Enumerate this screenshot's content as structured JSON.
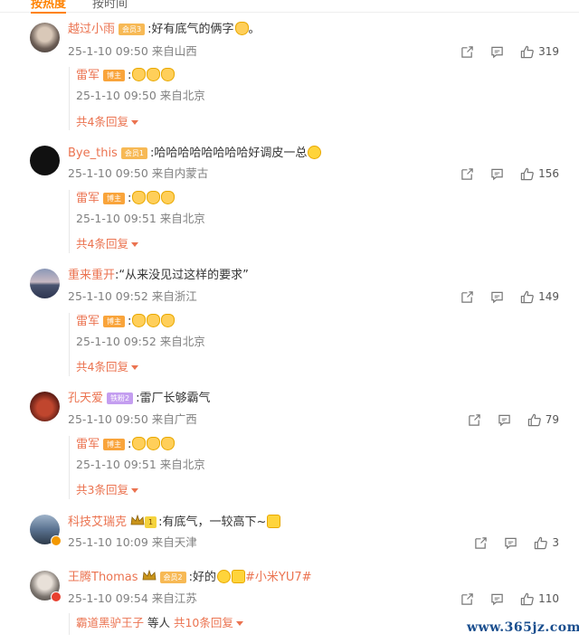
{
  "tabs": [
    {
      "label": "按热度",
      "active": true
    },
    {
      "label": "按时间",
      "active": false
    }
  ],
  "comments": [
    {
      "user": "越过小雨",
      "badge": "会员3",
      "text": ":好有底气的俩字",
      "meta": "25-1-10 09:50 来自山西",
      "likes": "319",
      "reply": {
        "user": "雷军",
        "tag": "博主",
        "text": ":",
        "meta": "25-1-10 09:50 来自北京"
      },
      "more": "共4条回复"
    },
    {
      "user": "Bye_this",
      "badge": "会员1",
      "text": ":哈哈哈哈哈哈哈哈好调皮一总",
      "meta": "25-1-10 09:50 来自内蒙古",
      "likes": "156",
      "reply": {
        "user": "雷军",
        "tag": "博主",
        "text": ":",
        "meta": "25-1-10 09:51 来自北京"
      },
      "more": "共4条回复"
    },
    {
      "user": "重来重开",
      "badge": "",
      "text": ":“从来没见过这样的要求”",
      "meta": "25-1-10 09:52 来自浙江",
      "likes": "149",
      "reply": {
        "user": "雷军",
        "tag": "博主",
        "text": ":",
        "meta": "25-1-10 09:52 来自北京"
      },
      "more": "共4条回复"
    },
    {
      "user": "孔天爱",
      "badge": "铁粉2",
      "text": ":雷厂长够霸气",
      "meta": "25-1-10 09:50 来自广西",
      "likes": "79",
      "reply": {
        "user": "雷军",
        "tag": "博主",
        "text": ":",
        "meta": "25-1-10 09:51 来自北京"
      },
      "more": "共3条回复"
    },
    {
      "user": "科技艾瑞克",
      "badge": "1",
      "text": ":有底气，一较高下~",
      "meta": "25-1-10 10:09 来自天津",
      "likes": "3"
    },
    {
      "user": "王腾Thomas",
      "badge": "会员2",
      "text": ":好的",
      "hashtag": "#小米YU7#",
      "meta": "25-1-10 09:54 来自江苏",
      "likes": "110"
    }
  ],
  "last_reply": {
    "user": "霸道黑驴王子",
    "mid": " 等人 ",
    "more": "共10条回复"
  },
  "watermark": "www.365jz.com",
  "colors": {
    "accent": "#eb7350",
    "meta": "#808080",
    "tab_active": "#ff8200"
  }
}
